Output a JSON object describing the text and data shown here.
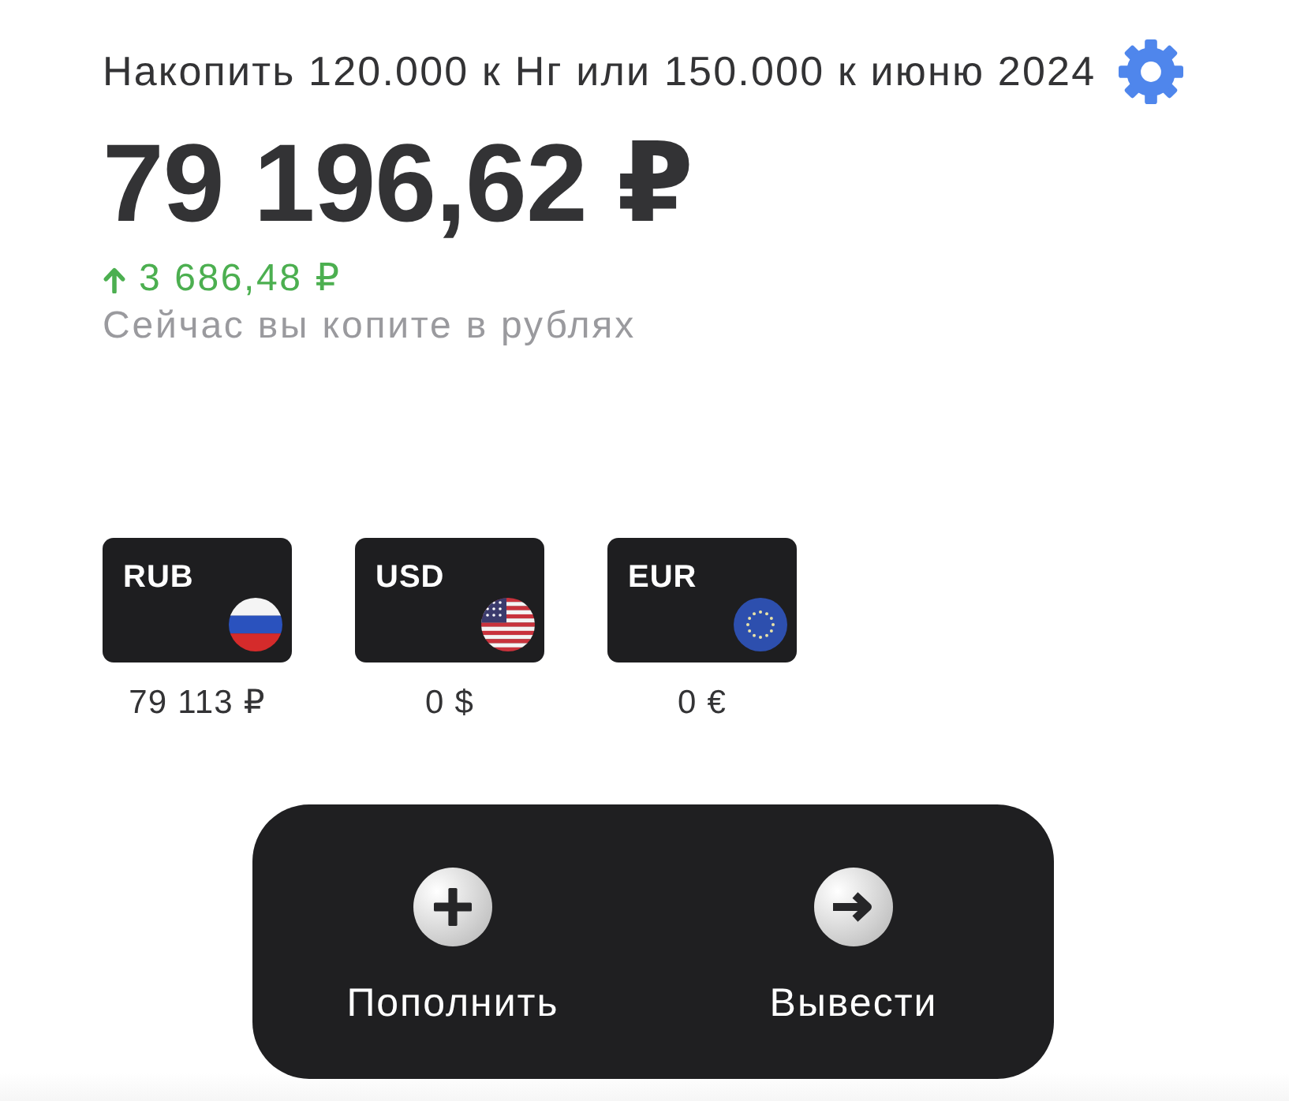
{
  "goal": {
    "title": "Накопить 120.000 к Нг или 150.000 к июню 2024"
  },
  "balance": {
    "amount": "79 196,62 ₽",
    "change": {
      "increased": true,
      "text": "3 686,48 ₽"
    },
    "note": "Сейчас вы копите в рублях"
  },
  "currencies": [
    {
      "code": "RUB",
      "kind": "ru",
      "amount": "79 113 ₽"
    },
    {
      "code": "USD",
      "kind": "us",
      "amount": "0 $"
    },
    {
      "code": "EUR",
      "kind": "eu",
      "amount": "0 €"
    }
  ],
  "actions": [
    {
      "kind": "plus",
      "label": "Пополнить"
    },
    {
      "kind": "arrow",
      "label": "Вывести"
    }
  ]
}
